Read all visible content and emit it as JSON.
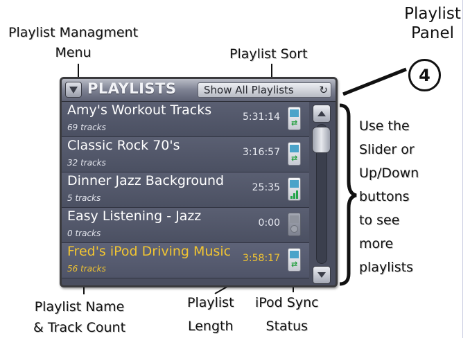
{
  "annotations": {
    "menu_label_line1": "Playlist Managment",
    "menu_label_line2": "Menu",
    "sort_label": "Playlist Sort",
    "panel_label_line1": "Playlist",
    "panel_label_line2": "Panel",
    "panel_number": "4",
    "scroll_help": [
      "Use the",
      "Slider or",
      "Up/Down",
      "buttons",
      "to see",
      "more",
      "playlists"
    ],
    "name_count_line1": "Playlist Name",
    "name_count_line2": "& Track Count",
    "length_line1": "Playlist",
    "length_line2": "Length",
    "sync_line1": "iPod Sync",
    "sync_line2": "Status"
  },
  "panel": {
    "title": "PLAYLISTS",
    "sort_value": "Show All Playlists",
    "sort_icon": "refresh-icon",
    "menu_icon": "triangle-down-icon"
  },
  "playlists": [
    {
      "name": "Amy's Workout Tracks",
      "count": "69 tracks",
      "length": "5:31:14",
      "sync": "synced",
      "active": false
    },
    {
      "name": "Classic Rock 70's",
      "count": "32 tracks",
      "length": "3:16:57",
      "sync": "synced",
      "active": false
    },
    {
      "name": "Dinner Jazz Background",
      "count": "5 tracks",
      "length": "25:35",
      "sync": "syncing",
      "active": false
    },
    {
      "name": "Easy Listening - Jazz",
      "count": "0 tracks",
      "length": "0:00",
      "sync": "not-synced",
      "active": false
    },
    {
      "name": "Fred's iPod Driving Music",
      "count": "56 tracks",
      "length": "3:58:17",
      "sync": "synced",
      "active": true
    }
  ],
  "scrollbar": {
    "position_fraction": 0.0
  },
  "colors": {
    "active_text": "#f2c531",
    "panel_bg": "#4a4e5f",
    "sync_green": "#22a44a"
  }
}
